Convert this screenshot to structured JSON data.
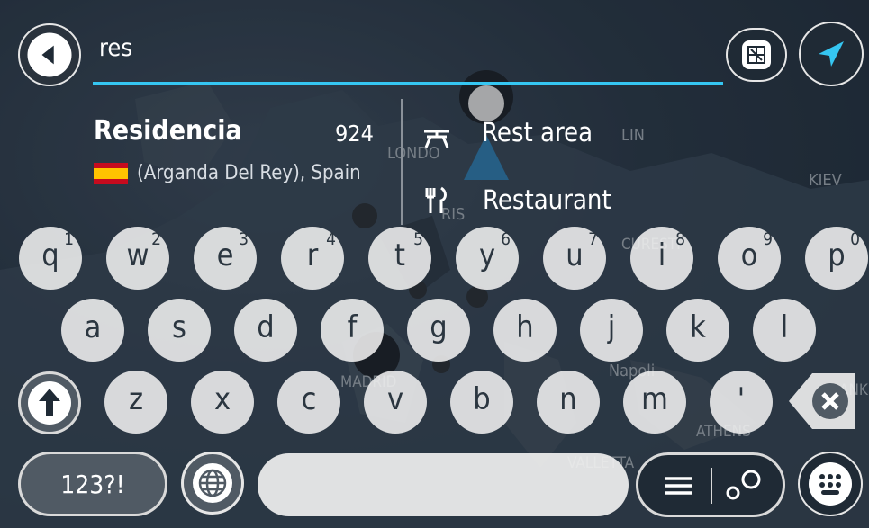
{
  "search": {
    "value": "res"
  },
  "icons": {
    "back": "arrow-left-icon",
    "map_view": "map-icon",
    "location": "navigation-arrow-icon",
    "rest_area": "picnic-table-icon",
    "restaurant": "fork-knife-icon",
    "shift": "arrow-up-icon",
    "globe": "globe-icon",
    "list": "list-icon",
    "route": "route-icon",
    "keyboard": "keyboard-icon",
    "backspace": "backspace-icon"
  },
  "suggestion": {
    "title": "Residencia",
    "distance": "924",
    "subtitle": "(Arganda Del Rey), Spain",
    "flag": "spain-flag"
  },
  "categories": [
    {
      "label": "Rest area"
    },
    {
      "label": "Restaurant"
    }
  ],
  "map_labels": [
    "LONDO",
    "LIN",
    "KIEV",
    "RIS",
    "Napoli",
    "MADRID",
    "ANK",
    "ATHENS",
    "VALLETTA",
    "CURESTI"
  ],
  "keyboard": {
    "row1": [
      {
        "ch": "q",
        "sup": "1"
      },
      {
        "ch": "w",
        "sup": "2"
      },
      {
        "ch": "e",
        "sup": "3"
      },
      {
        "ch": "r",
        "sup": "4"
      },
      {
        "ch": "t",
        "sup": "5"
      },
      {
        "ch": "y",
        "sup": "6"
      },
      {
        "ch": "u",
        "sup": "7"
      },
      {
        "ch": "i",
        "sup": "8"
      },
      {
        "ch": "o",
        "sup": "9"
      },
      {
        "ch": "p",
        "sup": "0"
      }
    ],
    "row2": [
      "a",
      "s",
      "d",
      "f",
      "g",
      "h",
      "j",
      "k",
      "l"
    ],
    "row3": [
      "z",
      "x",
      "c",
      "v",
      "b",
      "n",
      "m",
      "'"
    ],
    "num_label": "123?!"
  },
  "colors": {
    "accent": "#35c6f2",
    "flag_red": "#c60b1e",
    "flag_yellow": "#ffc400"
  }
}
